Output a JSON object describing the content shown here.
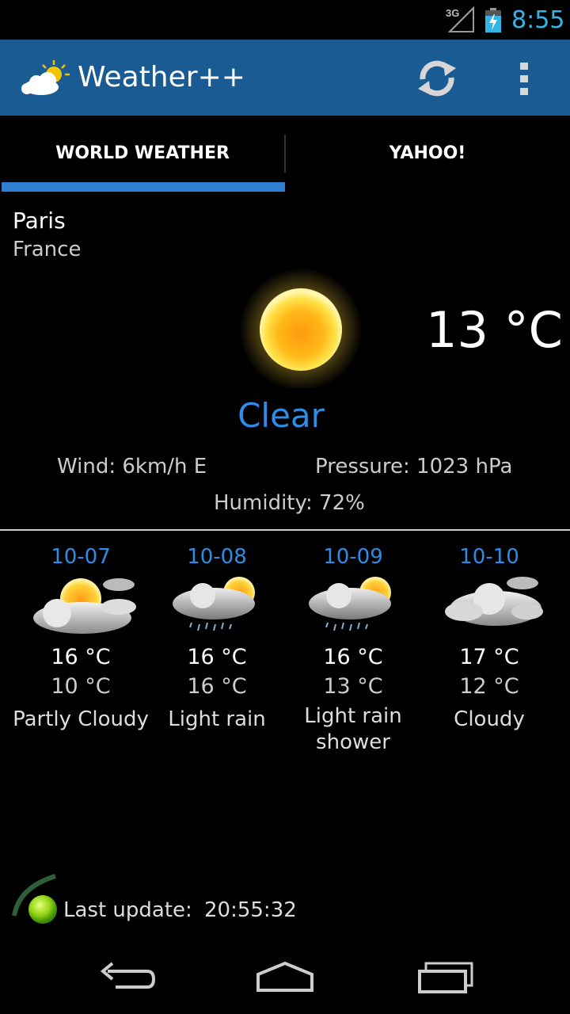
{
  "status_bar": {
    "network": "3G",
    "time": "8:55",
    "battery_icon": "battery-charging-icon",
    "signal_icon": "signal-icon"
  },
  "app": {
    "title": "Weather++",
    "logo_icon": "sun-cloud-logo-icon",
    "refresh_icon": "refresh-icon",
    "overflow_icon": "overflow-menu-icon"
  },
  "tabs": [
    {
      "label": "WORLD WEATHER",
      "selected": true
    },
    {
      "label": "YAHOO!",
      "selected": false
    }
  ],
  "location": {
    "city": "Paris",
    "country": "France"
  },
  "current": {
    "temperature": "13 °C",
    "condition": "Clear",
    "wind": "Wind: 6km/h E",
    "pressure": "Pressure: 1023 hPa",
    "humidity": "Humidity: 72%",
    "icon": "sun-icon"
  },
  "forecast": [
    {
      "date": "10-07",
      "high": "16 °C",
      "low": "10 °C",
      "desc": "Partly Cloudy",
      "icon": "partly-cloudy-icon"
    },
    {
      "date": "10-08",
      "high": "16 °C",
      "low": "16 °C",
      "desc": "Light rain",
      "icon": "light-rain-icon"
    },
    {
      "date": "10-09",
      "high": "16 °C",
      "low": "13 °C",
      "desc": "Light rain shower",
      "icon": "light-rain-shower-icon"
    },
    {
      "date": "10-10",
      "high": "17 °C",
      "low": "12 °C",
      "desc": "Cloudy",
      "icon": "cloudy-icon"
    }
  ],
  "last_update": {
    "label": "Last update:",
    "time": "20:55:32",
    "icon": "update-globe-icon"
  },
  "colors": {
    "accent": "#2e8be6",
    "action_bar": "#1a5b94",
    "tab_indicator": "#2e7fd0",
    "clock": "#33b5e5"
  },
  "nav_bar": {
    "back_icon": "back-icon",
    "home_icon": "home-icon",
    "recent_icon": "recent-apps-icon"
  }
}
